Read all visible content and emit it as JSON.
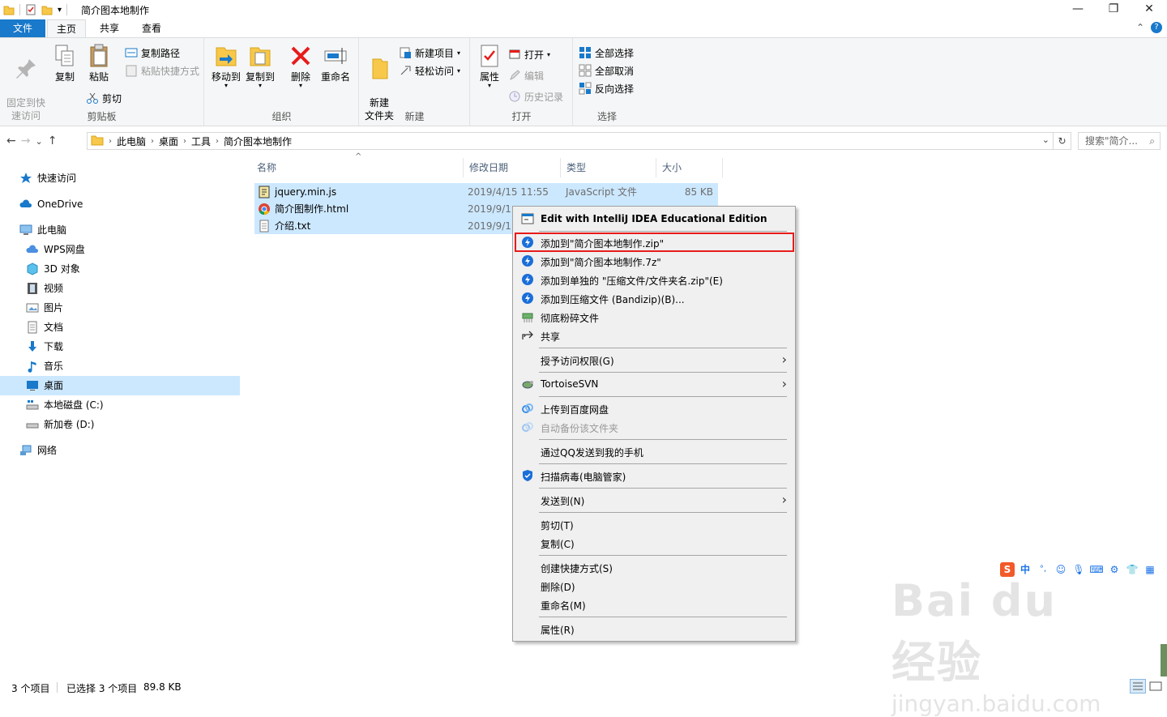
{
  "window": {
    "title": "简介图本地制作",
    "minimize": "—",
    "maximize": "❐",
    "close": "✕"
  },
  "ribbon_tabs": {
    "file": "文件",
    "home": "主页",
    "share": "共享",
    "view": "查看"
  },
  "ribbon": {
    "clipboard": {
      "pin": "固定到快\n速访问",
      "copy": "复制",
      "paste": "粘贴",
      "copy_path": "复制路径",
      "paste_shortcut": "粘贴快捷方式",
      "cut": "剪切",
      "label": "剪贴板"
    },
    "organize": {
      "move_to": "移动到",
      "copy_to": "复制到",
      "delete": "删除",
      "rename": "重命名",
      "label": "组织"
    },
    "new": {
      "new_folder": "新建\n文件夹",
      "new_item": "新建项目",
      "easy_access": "轻松访问",
      "label": "新建"
    },
    "open": {
      "properties": "属性",
      "open": "打开",
      "edit": "编辑",
      "history": "历史记录",
      "label": "打开"
    },
    "select": {
      "select_all": "全部选择",
      "select_none": "全部取消",
      "invert": "反向选择",
      "label": "选择"
    }
  },
  "address": {
    "crumbs": [
      "此电脑",
      "桌面",
      "工具",
      "简介图本地制作"
    ],
    "search_placeholder": "搜索\"简介...",
    "back": "←",
    "forward": "→",
    "dropdown": "⌄",
    "up": "↑",
    "refresh": "↻"
  },
  "nav": {
    "quick_access": "快速访问",
    "onedrive": "OneDrive",
    "this_pc": "此电脑",
    "wps": "WPS网盘",
    "objects3d": "3D 对象",
    "videos": "视频",
    "pictures": "图片",
    "documents": "文档",
    "downloads": "下载",
    "music": "音乐",
    "desktop": "桌面",
    "local_c": "本地磁盘 (C:)",
    "new_d": "新加卷 (D:)",
    "network": "网络"
  },
  "columns": {
    "name": "名称",
    "modified": "修改日期",
    "type": "类型",
    "size": "大小"
  },
  "files": [
    {
      "name": "jquery.min.js",
      "modified": "2019/4/15 11:55",
      "type": "JavaScript 文件",
      "size": "85 KB"
    },
    {
      "name": "简介图制作.html",
      "modified": "2019/9/1",
      "type": "",
      "size": ""
    },
    {
      "name": "介绍.txt",
      "modified": "2019/9/1",
      "type": "",
      "size": ""
    }
  ],
  "context_menu": {
    "idea": "Edit with IntelliJ IDEA Educational Edition",
    "add_zip": "添加到\"简介图本地制作.zip\"",
    "add_7z": "添加到\"简介图本地制作.7z\"",
    "add_each": "添加到单独的 \"压缩文件/文件夹名.zip\"(E)",
    "add_archive": "添加到压缩文件 (Bandizip)(B)...",
    "shred": "彻底粉碎文件",
    "share": "共享",
    "grant": "授予访问权限(G)",
    "svn": "TortoiseSVN",
    "baidu_upload": "上传到百度网盘",
    "baidu_backup": "自动备份该文件夹",
    "qq_send": "通过QQ发送到我的手机",
    "scan": "扫描病毒(电脑管家)",
    "send_to": "发送到(N)",
    "cut": "剪切(T)",
    "copy": "复制(C)",
    "shortcut": "创建快捷方式(S)",
    "delete": "删除(D)",
    "rename": "重命名(M)",
    "properties": "属性(R)"
  },
  "status": {
    "count": "3 个项目",
    "selected": "已选择 3 个项目",
    "size": "89.8 KB"
  },
  "ime": {
    "lang": "中",
    "punct": "°,"
  },
  "watermark": {
    "brand": "Bai du 经验",
    "url": "jingyan.baidu.com"
  },
  "colors": {
    "accent": "#1979ca",
    "selection": "#cce8ff",
    "highlight_border": "#e81b1b"
  }
}
